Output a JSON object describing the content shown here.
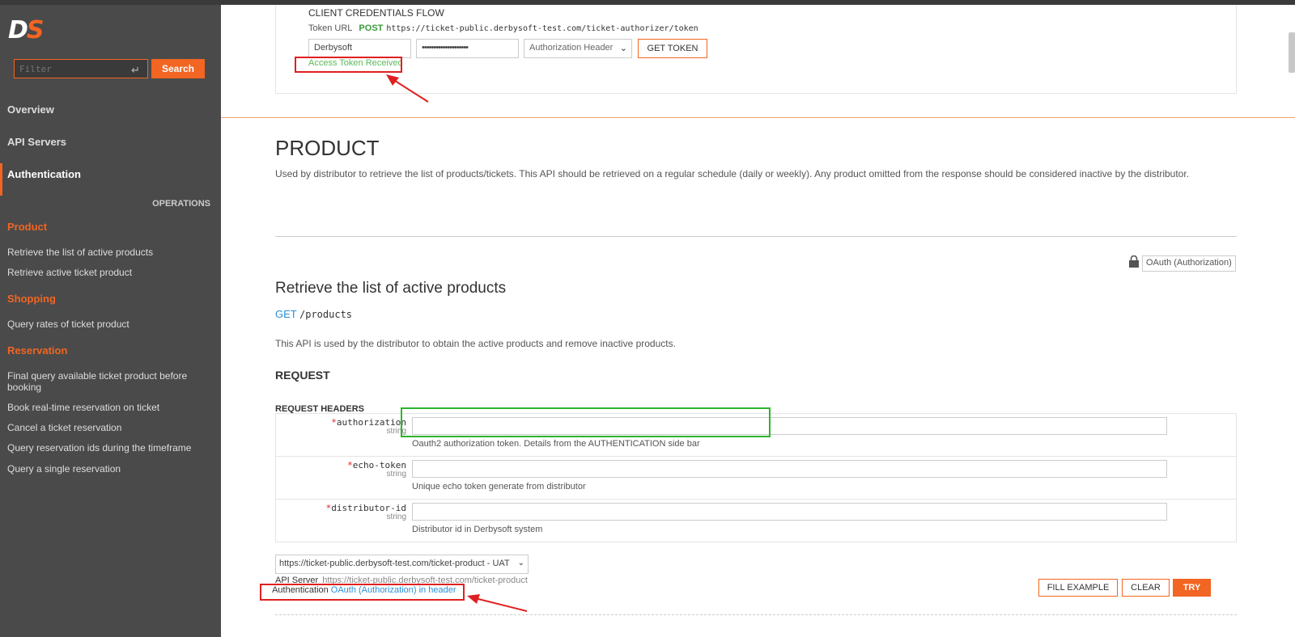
{
  "sidebar": {
    "logo": {
      "d": "D",
      "s": "S"
    },
    "filter_placeholder": "Filter",
    "search_label": "Search",
    "nav": [
      "Overview",
      "API Servers",
      "Authentication"
    ],
    "operations_label": "OPERATIONS",
    "sections": [
      {
        "title": "Product",
        "items": [
          "Retrieve the list of active products",
          "Retrieve active ticket product"
        ]
      },
      {
        "title": "Shopping",
        "items": [
          "Query rates of ticket product"
        ]
      },
      {
        "title": "Reservation",
        "items": [
          "Final query available ticket product before booking",
          "Book real-time reservation on ticket",
          "Cancel a ticket reservation",
          "Query reservation ids during the timeframe",
          "Query a single reservation"
        ]
      }
    ]
  },
  "credentials": {
    "title": "CLIENT CREDENTIALS FLOW",
    "token_url_label": "Token URL",
    "method": "POST",
    "token_url": "https://ticket-public.derbysoft-test.com/ticket-authorizer/token",
    "client_id": "Derbysoft",
    "client_secret": "••••••••••••••••••••",
    "auth_mode": "Authorization Header",
    "get_token_label": "GET TOKEN",
    "status": "Access Token Received"
  },
  "product": {
    "title": "PRODUCT",
    "description": "Used by distributor to retrieve the list of products/tickets. This API should be retrieved on a regular schedule (daily or weekly). Any product omitted from the response should be considered inactive by the distributor."
  },
  "endpoint": {
    "oauth_badge": "OAuth (Authorization)",
    "title": "Retrieve the list of active products",
    "method": "GET",
    "path": "/products",
    "description": "This API is used by the distributor to obtain the active products and remove inactive products.",
    "request_label": "REQUEST",
    "request_headers_label": "REQUEST HEADERS",
    "headers": [
      {
        "name": "authorization",
        "type": "string",
        "description": "Oauth2 authorization token. Details from the AUTHENTICATION side bar"
      },
      {
        "name": "echo-token",
        "type": "string",
        "description": "Unique echo token generate from distributor"
      },
      {
        "name": "distributor-id",
        "type": "string",
        "description": "Distributor id in Derbysoft system"
      }
    ],
    "server_option": "https://ticket-public.derbysoft-test.com/ticket-product - UAT",
    "api_server_label": "API Server",
    "api_server_value": "https://ticket-public.derbysoft-test.com/ticket-product",
    "authentication_label": "Authentication",
    "authentication_value": "OAuth (Authorization) in header",
    "fill_example_label": "FILL EXAMPLE",
    "clear_label": "CLEAR",
    "try_label": "TRY"
  }
}
